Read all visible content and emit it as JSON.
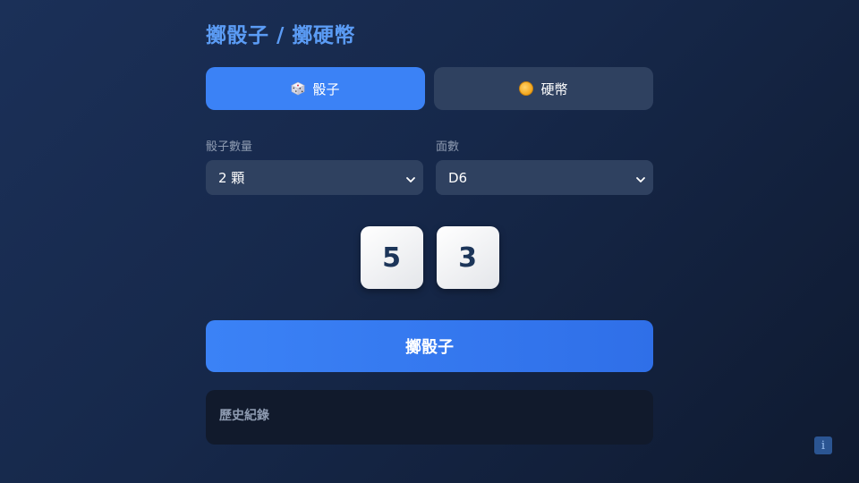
{
  "header": {
    "title": "擲骰子 / 擲硬幣"
  },
  "mode_tabs": [
    {
      "label": "骰子",
      "icon": "dice-icon",
      "active": true
    },
    {
      "label": "硬幣",
      "icon": "coin-icon",
      "active": false
    }
  ],
  "settings": {
    "dice_count_label": "骰子數量",
    "dice_count_value": "2 顆",
    "faces_label": "面數",
    "faces_value": "D6"
  },
  "dice_results": [
    "5",
    "3"
  ],
  "roll_button_label": "擲骰子",
  "history": {
    "title": "歷史紀錄"
  },
  "info_button": {
    "icon": "info-icon",
    "label": "i"
  },
  "colors": {
    "accent": "#3b82f6",
    "title": "#5b9cf5",
    "panel": "#2f4160",
    "background": "#16284a"
  }
}
